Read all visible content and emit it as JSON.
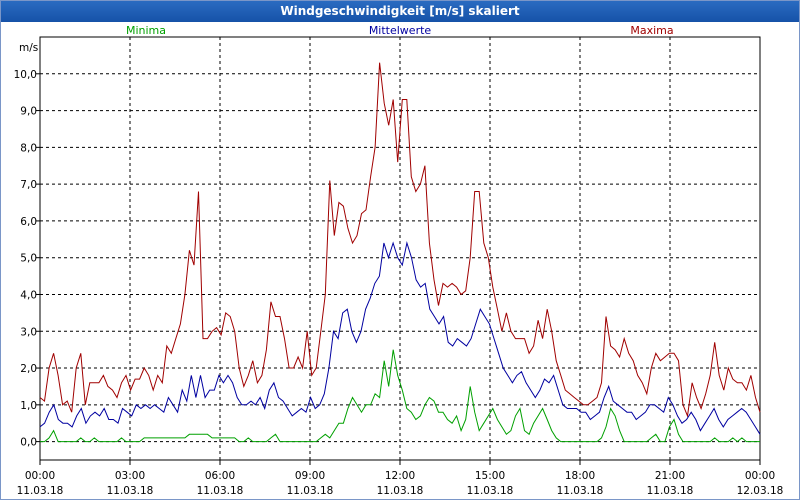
{
  "title": "Windgeschwindigkeit [m/s] skaliert",
  "chart_data": {
    "type": "line",
    "ylabel": "m/s",
    "ylim": [
      -0.5,
      11.0
    ],
    "y_ticks": [
      "0,0",
      "1,0",
      "2,0",
      "3,0",
      "4,0",
      "5,0",
      "6,0",
      "7,0",
      "8,0",
      "9,0",
      "10,0"
    ],
    "x_ticks": [
      {
        "time": "00:00",
        "date": "11.03.18"
      },
      {
        "time": "03:00",
        "date": "11.03.18"
      },
      {
        "time": "06:00",
        "date": "11.03.18"
      },
      {
        "time": "09:00",
        "date": "11.03.18"
      },
      {
        "time": "12:00",
        "date": "11.03.18"
      },
      {
        "time": "15:00",
        "date": "11.03.18"
      },
      {
        "time": "18:00",
        "date": "11.03.18"
      },
      {
        "time": "21:00",
        "date": "11.03.18"
      },
      {
        "time": "00:00",
        "date": "12.03.18"
      }
    ],
    "x_start": "11.03.18 00:00",
    "x_end": "12.03.18 00:00",
    "sample_interval_minutes": 10,
    "grid": true,
    "series": [
      {
        "name": "Maxima",
        "color": "#a00000",
        "values": [
          1.2,
          1.1,
          2.0,
          2.4,
          1.8,
          1.0,
          1.1,
          0.8,
          2.0,
          2.4,
          1.0,
          1.6,
          1.6,
          1.6,
          1.8,
          1.5,
          1.4,
          1.2,
          1.6,
          1.8,
          1.4,
          1.7,
          1.7,
          2.0,
          1.8,
          1.4,
          1.8,
          1.6,
          2.6,
          2.4,
          2.8,
          3.2,
          4.0,
          5.2,
          4.8,
          6.8,
          2.8,
          2.8,
          3.0,
          3.1,
          2.9,
          3.5,
          3.4,
          3.0,
          2.0,
          1.5,
          1.8,
          2.2,
          1.6,
          1.8,
          2.5,
          3.8,
          3.4,
          3.4,
          2.8,
          2.0,
          2.0,
          2.3,
          2.0,
          3.0,
          1.8,
          2.0,
          3.0,
          4.0,
          7.1,
          5.6,
          6.5,
          6.4,
          5.8,
          5.4,
          5.6,
          6.2,
          6.3,
          7.2,
          8.0,
          10.3,
          9.2,
          8.6,
          9.3,
          7.6,
          9.3,
          9.3,
          7.2,
          6.8,
          7.0,
          7.5,
          5.4,
          4.4,
          3.7,
          4.3,
          4.2,
          4.3,
          4.2,
          4.0,
          4.1,
          5.0,
          6.8,
          6.8,
          5.4,
          5.0,
          4.2,
          3.6,
          3.0,
          3.5,
          3.0,
          2.8,
          2.8,
          2.8,
          2.4,
          2.6,
          3.3,
          2.8,
          3.6,
          3.0,
          2.2,
          1.8,
          1.4,
          1.3,
          1.2,
          1.1,
          1.0,
          1.0,
          1.1,
          1.2,
          1.6,
          3.4,
          2.6,
          2.5,
          2.3,
          2.8,
          2.4,
          2.2,
          1.8,
          1.6,
          1.3,
          2.0,
          2.4,
          2.2,
          2.3,
          2.4,
          2.4,
          2.2,
          1.0,
          0.7,
          1.6,
          1.2,
          0.9,
          1.3,
          1.8,
          2.7,
          1.8,
          1.4,
          2.0,
          1.7,
          1.6,
          1.6,
          1.4,
          1.8,
          1.2,
          0.8
        ]
      },
      {
        "name": "Mittelwerte",
        "color": "#0000a0",
        "values": [
          0.4,
          0.5,
          0.8,
          1.0,
          0.6,
          0.5,
          0.5,
          0.4,
          0.7,
          0.9,
          0.5,
          0.7,
          0.8,
          0.7,
          0.9,
          0.6,
          0.6,
          0.5,
          0.9,
          0.8,
          0.7,
          1.0,
          0.9,
          1.0,
          0.9,
          1.0,
          0.9,
          0.8,
          1.2,
          1.0,
          0.8,
          1.4,
          1.1,
          1.8,
          1.2,
          1.8,
          1.2,
          1.4,
          1.4,
          1.8,
          1.6,
          1.8,
          1.6,
          1.2,
          1.0,
          1.0,
          1.1,
          1.0,
          1.2,
          0.9,
          1.4,
          1.6,
          1.2,
          1.1,
          0.9,
          0.7,
          0.8,
          0.9,
          0.8,
          1.2,
          0.9,
          1.0,
          1.3,
          2.0,
          3.0,
          2.8,
          3.5,
          3.6,
          3.0,
          2.7,
          3.0,
          3.6,
          3.9,
          4.3,
          4.5,
          5.4,
          5.0,
          5.4,
          5.0,
          4.8,
          5.4,
          5.0,
          4.4,
          4.2,
          4.3,
          3.6,
          3.4,
          3.2,
          3.4,
          2.7,
          2.6,
          2.8,
          2.7,
          2.6,
          2.8,
          3.2,
          3.6,
          3.4,
          3.2,
          2.8,
          2.4,
          2.0,
          1.8,
          1.6,
          1.8,
          1.9,
          1.6,
          1.4,
          1.2,
          1.4,
          1.7,
          1.6,
          1.8,
          1.4,
          1.0,
          0.9,
          0.9,
          0.9,
          0.8,
          0.8,
          0.6,
          0.7,
          0.8,
          1.2,
          1.5,
          1.1,
          1.0,
          0.9,
          0.8,
          0.8,
          0.6,
          0.7,
          0.8,
          1.0,
          1.0,
          0.9,
          0.8,
          1.2,
          1.0,
          0.7,
          0.5,
          0.6,
          0.8,
          0.6,
          0.3,
          0.5,
          0.7,
          0.9,
          0.6,
          0.4,
          0.6,
          0.7,
          0.8,
          0.9,
          0.8,
          0.6,
          0.4,
          0.2
        ]
      },
      {
        "name": "Minima",
        "color": "#00a000",
        "values": [
          0.0,
          0.0,
          0.1,
          0.3,
          0.0,
          0.0,
          0.0,
          0.0,
          0.0,
          0.1,
          0.0,
          0.0,
          0.1,
          0.0,
          0.0,
          0.0,
          0.0,
          0.0,
          0.1,
          0.0,
          0.0,
          0.0,
          0.0,
          0.1,
          0.1,
          0.1,
          0.1,
          0.1,
          0.1,
          0.1,
          0.1,
          0.1,
          0.1,
          0.2,
          0.2,
          0.2,
          0.2,
          0.2,
          0.1,
          0.1,
          0.1,
          0.1,
          0.1,
          0.1,
          0.0,
          0.0,
          0.1,
          0.0,
          0.0,
          0.0,
          0.0,
          0.1,
          0.2,
          0.0,
          0.0,
          0.0,
          0.0,
          0.0,
          0.0,
          0.0,
          0.0,
          0.0,
          0.1,
          0.2,
          0.1,
          0.3,
          0.5,
          0.5,
          0.9,
          1.2,
          1.0,
          0.8,
          1.0,
          1.0,
          1.3,
          1.2,
          2.2,
          1.5,
          2.5,
          1.8,
          1.4,
          0.9,
          0.8,
          0.6,
          0.7,
          1.0,
          1.2,
          1.1,
          0.8,
          0.8,
          0.6,
          0.5,
          0.7,
          0.3,
          0.6,
          1.5,
          0.8,
          0.3,
          0.5,
          0.7,
          0.9,
          0.6,
          0.4,
          0.2,
          0.3,
          0.7,
          0.9,
          0.3,
          0.2,
          0.5,
          0.7,
          0.9,
          0.6,
          0.3,
          0.1,
          0.0,
          0.0,
          0.0,
          0.0,
          0.0,
          0.0,
          0.0,
          0.0,
          0.0,
          0.1,
          0.4,
          0.9,
          0.7,
          0.3,
          0.0,
          0.0,
          0.0,
          0.0,
          0.0,
          0.0,
          0.1,
          0.2,
          0.0,
          0.0,
          0.4,
          0.6,
          0.2,
          0.0,
          0.0,
          0.0,
          0.0,
          0.0,
          0.0,
          0.0,
          0.1,
          0.0,
          0.0,
          0.0,
          0.1,
          0.0,
          0.1,
          0.0,
          0.0,
          0.0,
          0.0
        ]
      }
    ]
  }
}
